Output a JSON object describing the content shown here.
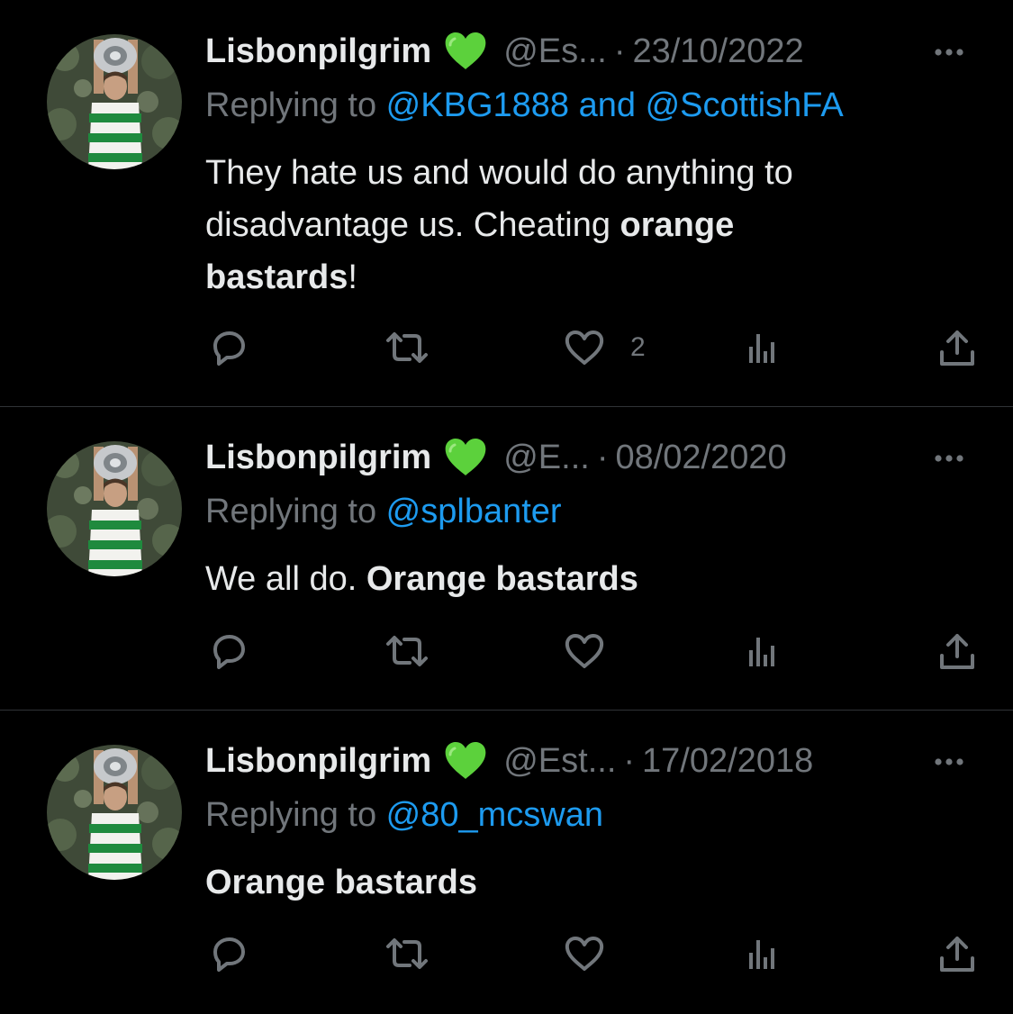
{
  "tweets": [
    {
      "name": "Lisbonpilgrim",
      "handle": "@Es...",
      "separator": "·",
      "date": "23/10/2022",
      "reply_prefix": "Replying to ",
      "reply_mention_1": "@KBG1888",
      "reply_joiner": " and ",
      "reply_mention_2": "@ScottishFA",
      "text_line_1": "They hate us and would do anything to",
      "text_line_2_plain": "disadvantage us. Cheating ",
      "text_line_2_bold": "orange",
      "text_line_3_bold": "bastards",
      "text_line_3_plain": "!",
      "like_count": "2"
    },
    {
      "name": "Lisbonpilgrim",
      "handle": "@E...",
      "separator": "·",
      "date": "08/02/2020",
      "reply_prefix": "Replying to ",
      "reply_mention_1": "@splbanter",
      "text_plain": "We all do. ",
      "text_bold": "Orange bastards"
    },
    {
      "name": "Lisbonpilgrim",
      "handle": "@Est...",
      "separator": "·",
      "date": "17/02/2018",
      "reply_prefix": "Replying to ",
      "reply_mention_1": "@80_mcswan",
      "text_bold": "Orange bastards"
    }
  ],
  "icons": {
    "badge": "green-heart-icon",
    "more": "more-options-icon",
    "reply": "reply-icon",
    "retweet": "retweet-icon",
    "like": "like-icon",
    "views": "views-icon",
    "share": "share-icon"
  },
  "colors": {
    "background": "#000000",
    "text": "#e7e9ea",
    "muted": "#71767b",
    "link": "#1d9bf0",
    "divider": "#2f3336",
    "heart": "#5cd13c"
  }
}
